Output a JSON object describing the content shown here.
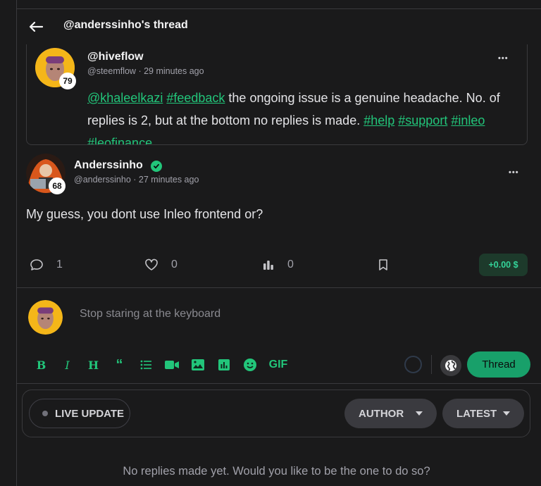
{
  "header": {
    "title": "@anderssinho's thread"
  },
  "quoted_post": {
    "author_name": "@hiveflow",
    "author_handle": "@steemflow",
    "time": "29 minutes ago",
    "reputation": "79",
    "more_label": "•••",
    "body_parts": [
      {
        "text": "@khaleelkazi",
        "link": true
      },
      {
        "text": " ",
        "link": false
      },
      {
        "text": "#feedback",
        "link": true
      },
      {
        "text": " the ongoing issue is a genuine headache. No. of replies is 2, but at the bottom no replies is made. ",
        "link": false
      },
      {
        "text": "#help",
        "link": true
      },
      {
        "text": " ",
        "link": false
      },
      {
        "text": "#support",
        "link": true
      },
      {
        "text": " ",
        "link": false
      },
      {
        "text": "#inleo",
        "link": true
      },
      {
        "text": " ",
        "link": false
      },
      {
        "text": "#leofinance",
        "link": true
      }
    ]
  },
  "main_post": {
    "author_name": "Anderssinho",
    "author_handle": "@anderssinho",
    "time": "27 minutes ago",
    "reputation": "68",
    "more_label": "•••",
    "body": "My guess, you dont use Inleo frontend or?",
    "replies": "1",
    "likes": "0",
    "views": "0",
    "reward": "+0.00 $"
  },
  "composer": {
    "placeholder": "Stop staring at the keyboard",
    "gif_label": "GIF",
    "submit_label": "Thread"
  },
  "filters": {
    "live_label": "LIVE UPDATE",
    "author_label": "AUTHOR",
    "sort_label": "LATEST"
  },
  "empty_state": "No replies made yet. Would you like to be the one to do so?",
  "colors": {
    "accent": "#22c57a",
    "background": "#1a1a1b",
    "button": "#18a06a"
  }
}
